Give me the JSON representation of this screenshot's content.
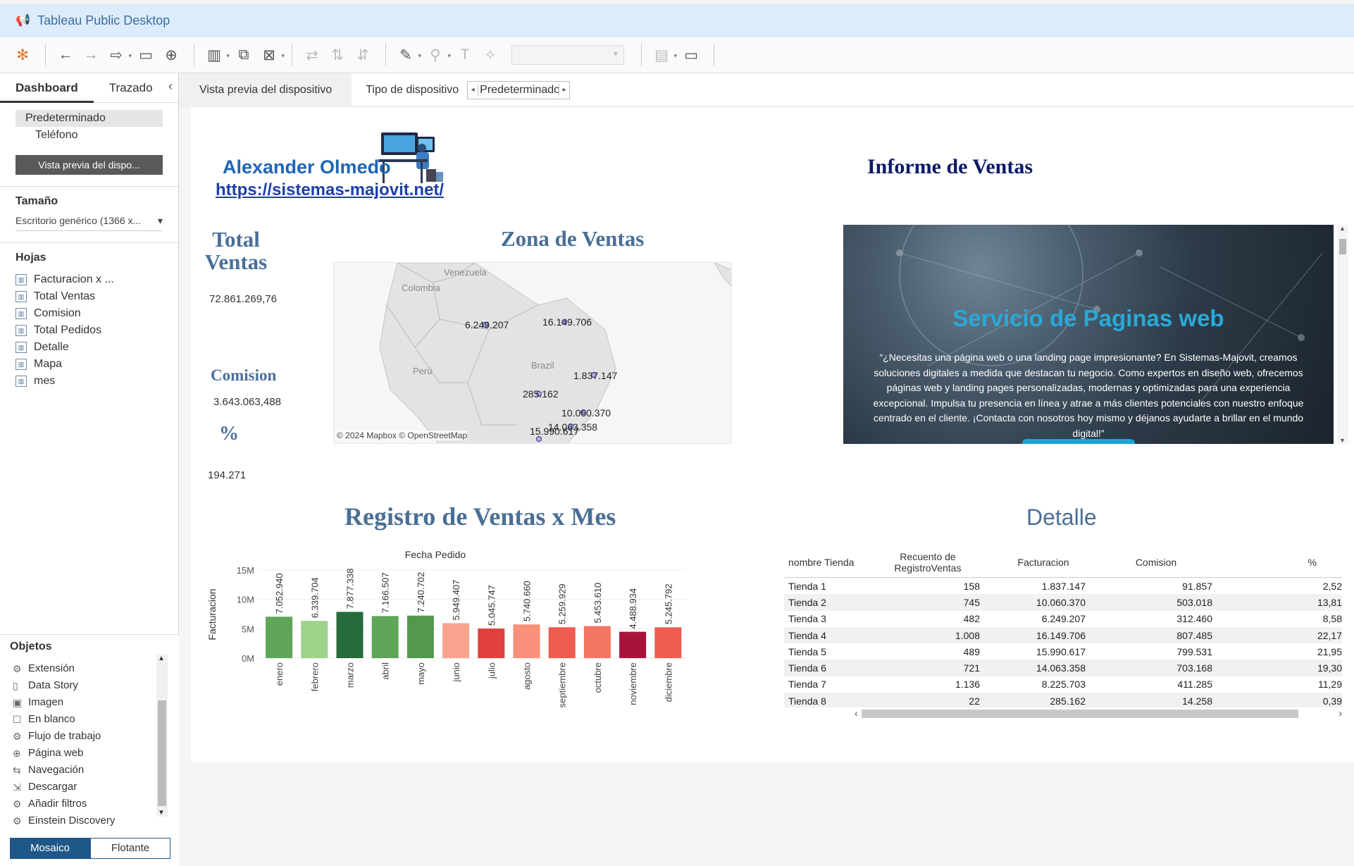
{
  "app": {
    "title": "Tableau Public Desktop"
  },
  "left": {
    "tabs": [
      "Dashboard",
      "Trazado"
    ],
    "devices": [
      "Predeterminado",
      "Teléfono"
    ],
    "preview_button": "Vista previa del dispo...",
    "size_title": "Tamaño",
    "size_value": "Escritorio genérico (1366 x...",
    "sheets_title": "Hojas",
    "sheets": [
      "Facturacion x ...",
      "Total Ventas",
      "Comision",
      "Total Pedidos",
      "Detalle",
      "Mapa",
      "mes"
    ],
    "objects_title": "Objetos",
    "objects": [
      {
        "label": "Extensión",
        "icon": "puzzle-icon"
      },
      {
        "label": "Data Story",
        "icon": "story-icon"
      },
      {
        "label": "Imagen",
        "icon": "image-icon"
      },
      {
        "label": "En blanco",
        "icon": "blank-icon"
      },
      {
        "label": "Flujo de trabajo",
        "icon": "workflow-icon"
      },
      {
        "label": "Página web",
        "icon": "globe-icon"
      },
      {
        "label": "Navegación",
        "icon": "navigation-icon"
      },
      {
        "label": "Descargar",
        "icon": "download-icon"
      },
      {
        "label": "Añadir filtros",
        "icon": "filter-icon"
      },
      {
        "label": "Einstein Discovery",
        "icon": "einstein-icon"
      }
    ],
    "mode_tiled": "Mosaico",
    "mode_floating": "Flotante"
  },
  "device_bar": {
    "preview": "Vista previa del dispositivo",
    "type_label": "Tipo de dispositivo",
    "type_value": "Predeterminado"
  },
  "dashboard": {
    "logo_name": "Alexander Olmedo",
    "logo_url": "https://sistemas-majovit.net/",
    "title": "Informe de Ventas",
    "kpi_total_label_1": "Total",
    "kpi_total_label_2": "Ventas",
    "kpi_total_value": "72.861.269,76",
    "kpi_comision_label": "Comision",
    "kpi_comision_value": "3.643.063,488",
    "kpi_pct_label": "%",
    "kpi_pct_value": "194.271",
    "map_title": "Zona de Ventas",
    "map_labels": {
      "venezuela": "Venezuela",
      "colombia": "Colombia",
      "brazil": "Brazil",
      "peru": "Perú",
      "copyright": "© 2024 Mapbox © OpenStreetMap"
    },
    "map_values": [
      "6.249.207",
      "16.149.706",
      "1.837.147",
      "285.162",
      "10.060.370",
      "14.063.358",
      "15.990.617"
    ],
    "promo_title": "Servicio de Paginas web",
    "promo_text": "“¿Necesitas una página web o una landing page impresionante? En Sistemas-Majovit, creamos soluciones digitales a medida que destacan tu negocio. Como expertos en diseño web, ofrecemos páginas web y landing pages personalizadas, modernas y optimizadas para una experiencia excepcional. Impulsa tu presencia en línea y atrae a más clientes potenciales con nuestro enfoque centrado en el cliente. ¡Contacta con nosotros hoy mismo y déjanos ayudarte a brillar en el mundo digital!”",
    "chart_title": "Registro de Ventas x Mes",
    "detail_title": "Detalle"
  },
  "chart_data": {
    "type": "bar",
    "title": "Fecha  Pedido",
    "ylabel": "Facturacion",
    "ylim": [
      0,
      15000000
    ],
    "yticks": [
      "0M",
      "5M",
      "10M",
      "15M"
    ],
    "categories": [
      "enero",
      "febrero",
      "marzo",
      "abril",
      "mayo",
      "junio",
      "julio",
      "agosto",
      "septiembre",
      "octubre",
      "noviembre",
      "diciembre"
    ],
    "values": [
      7052940,
      6339704,
      7877338,
      7166507,
      7240702,
      5949407,
      5045747,
      5740660,
      5259929,
      5453610,
      4488934,
      5245792
    ],
    "labels": [
      "7.052.940",
      "6.339.704",
      "7.877.338",
      "7.166.507",
      "7.240.702",
      "5.949.407",
      "5.045.747",
      "5.740.660",
      "5.259.929",
      "5.453.610",
      "4.488.934",
      "5.245.792"
    ],
    "colors": [
      "#5ea55a",
      "#9bd389",
      "#266b3b",
      "#5ea55a",
      "#52984f",
      "#f7a38f",
      "#e1403e",
      "#f8907a",
      "#ee5c4f",
      "#f27664",
      "#a8133c",
      "#ee5c4f"
    ]
  },
  "detail_table": {
    "headers": [
      "nombre Tienda",
      "Recuento de RegistroVentas",
      "Facturacion",
      "Comision",
      "%"
    ],
    "rows": [
      [
        "Tienda 1",
        "158",
        "1.837.147",
        "91.857",
        "2,52"
      ],
      [
        "Tienda 2",
        "745",
        "10.060.370",
        "503.018",
        "13,81"
      ],
      [
        "Tienda 3",
        "482",
        "6.249.207",
        "312.460",
        "8,58"
      ],
      [
        "Tienda 4",
        "1.008",
        "16.149.706",
        "807.485",
        "22,17"
      ],
      [
        "Tienda 5",
        "489",
        "15.990.617",
        "799.531",
        "21,95"
      ],
      [
        "Tienda 6",
        "721",
        "14.063.358",
        "703.168",
        "19,30"
      ],
      [
        "Tienda 7",
        "1.136",
        "8.225.703",
        "411.285",
        "11,29"
      ],
      [
        "Tienda 8",
        "22",
        "285.162",
        "14.258",
        "0,39"
      ]
    ]
  }
}
